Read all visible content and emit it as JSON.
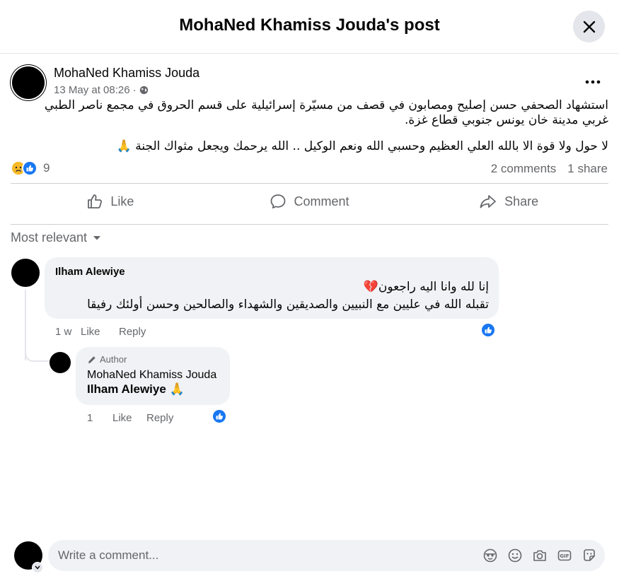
{
  "header": {
    "title": "MohaNed Khamiss Jouda's post"
  },
  "post": {
    "author": "MohaNed Khamiss Jouda",
    "timestamp": "13 May at 08:26",
    "separator": "·",
    "text_line1": "استشهاد الصحفي حسن إصليح ومصابون في قصف من مسيّرة إسرائيلية على قسم الحروق في مجمع ناصر الطبي غربي مدينة خان يونس جنوبي قطاع غزة.",
    "text_line2": "لا حول ولا قوة الا بالله العلي العظيم وحسبي الله ونعم الوكيل  .. الله يرحمك ويجعل مثواك الجنة 🙏",
    "reaction_count": "9",
    "comments_count": "2 comments",
    "shares_count": "1 share"
  },
  "actions": {
    "like": "Like",
    "comment": "Comment",
    "share": "Share"
  },
  "comments_sort": "Most relevant",
  "comments": [
    {
      "author": "Ilham Alewiye",
      "line1": "إنا لله وانا اليه راجعون💔",
      "line2": "تقبله الله في عليين مع النبيين والصديقين والشهداء والصالحين وحسن أولئك رفيقا",
      "time": "1 w",
      "like": "Like",
      "reply": "Reply"
    }
  ],
  "reply": {
    "badge": "Author",
    "author": "MohaNed Khamiss Jouda",
    "text": "Ilham Alewiye 🙏",
    "time": "1",
    "like": "Like",
    "reply": "Reply"
  },
  "composer": {
    "placeholder": "Write a comment..."
  },
  "colors": {
    "accent": "#1877f2",
    "muted": "#65676b",
    "bubble": "#f0f2f5"
  }
}
